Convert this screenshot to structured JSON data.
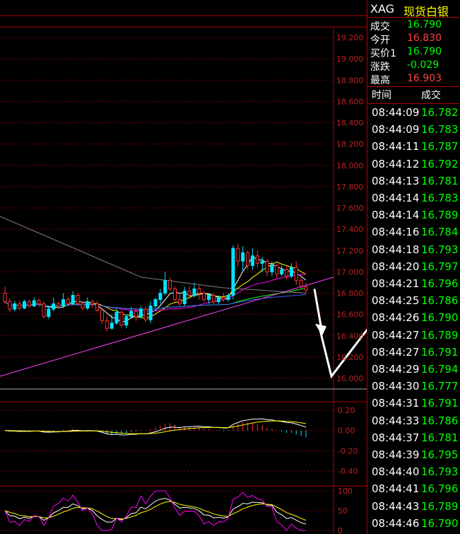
{
  "header": {
    "symbol": "XAG",
    "name": "现货白银"
  },
  "quote": [
    {
      "label": "成交",
      "value": "16.790",
      "color": "#00ff00"
    },
    {
      "label": "今开",
      "value": "16.830",
      "color": "#ff4040"
    },
    {
      "label": "买价1",
      "value": "16.790",
      "color": "#00ff00"
    },
    {
      "label": "涨跌",
      "value": "-0.029",
      "color": "#00ff00"
    },
    {
      "label": "最高",
      "value": "16.903",
      "color": "#ff4040"
    }
  ],
  "ticks_header": {
    "time": "时间",
    "price": "成交"
  },
  "ticks": [
    {
      "time": "08:44:09",
      "price": "16.782"
    },
    {
      "time": "08:44:09",
      "price": "16.783"
    },
    {
      "time": "08:44:11",
      "price": "16.787"
    },
    {
      "time": "08:44:12",
      "price": "16.792"
    },
    {
      "time": "08:44:13",
      "price": "16.781"
    },
    {
      "time": "08:44:14",
      "price": "16.783"
    },
    {
      "time": "08:44:14",
      "price": "16.789"
    },
    {
      "time": "08:44:16",
      "price": "16.784"
    },
    {
      "time": "08:44:18",
      "price": "16.793"
    },
    {
      "time": "08:44:20",
      "price": "16.797"
    },
    {
      "time": "08:44:21",
      "price": "16.796"
    },
    {
      "time": "08:44:25",
      "price": "16.786"
    },
    {
      "time": "08:44:26",
      "price": "16.790"
    },
    {
      "time": "08:44:27",
      "price": "16.789"
    },
    {
      "time": "08:44:27",
      "price": "16.791"
    },
    {
      "time": "08:44:29",
      "price": "16.794"
    },
    {
      "time": "08:44:30",
      "price": "16.777"
    },
    {
      "time": "08:44:31",
      "price": "16.791"
    },
    {
      "time": "08:44:33",
      "price": "16.786"
    },
    {
      "time": "08:44:37",
      "price": "16.781"
    },
    {
      "time": "08:44:39",
      "price": "16.795"
    },
    {
      "time": "08:44:40",
      "price": "16.793"
    },
    {
      "time": "08:44:41",
      "price": "16.796"
    },
    {
      "time": "08:44:43",
      "price": "16.789"
    },
    {
      "time": "08:44:46",
      "price": "16.790"
    }
  ],
  "chart_data": {
    "type": "candlestick",
    "price_axis": {
      "ticks": [
        "19.200",
        "19.000",
        "18.800",
        "18.600",
        "18.400",
        "18.200",
        "18.000",
        "17.800",
        "17.600",
        "17.400",
        "17.200",
        "17.000",
        "16.800",
        "16.600",
        "16.400",
        "16.200",
        "16.000"
      ],
      "range": [
        16.0,
        19.2
      ]
    },
    "macd_axis": {
      "ticks": [
        "0.20",
        "0.00",
        "-0.20",
        "-0.40"
      ],
      "range": [
        -0.4,
        0.2
      ]
    },
    "kdj_axis": {
      "ticks": [
        "100",
        "50",
        "0"
      ],
      "range": [
        0,
        100
      ]
    },
    "candles": [
      [
        16.8,
        16.72,
        16.7,
        16.86
      ],
      [
        16.72,
        16.65,
        16.62,
        16.75
      ],
      [
        16.65,
        16.7,
        16.63,
        16.73
      ],
      [
        16.7,
        16.66,
        16.64,
        16.73
      ],
      [
        16.66,
        16.72,
        16.65,
        16.74
      ],
      [
        16.72,
        16.68,
        16.66,
        16.74
      ],
      [
        16.68,
        16.73,
        16.67,
        16.76
      ],
      [
        16.73,
        16.7,
        16.67,
        16.75
      ],
      [
        16.7,
        16.58,
        16.56,
        16.72
      ],
      [
        16.58,
        16.65,
        16.56,
        16.68
      ],
      [
        16.65,
        16.7,
        16.63,
        16.76
      ],
      [
        16.7,
        16.68,
        16.66,
        16.72
      ],
      [
        16.68,
        16.74,
        16.66,
        16.8
      ],
      [
        16.74,
        16.7,
        16.68,
        16.76
      ],
      [
        16.7,
        16.78,
        16.69,
        16.82
      ],
      [
        16.78,
        16.7,
        16.68,
        16.8
      ],
      [
        16.7,
        16.66,
        16.64,
        16.72
      ],
      [
        16.66,
        16.72,
        16.64,
        16.76
      ],
      [
        16.72,
        16.7,
        16.66,
        16.74
      ],
      [
        16.7,
        16.64,
        16.62,
        16.73
      ],
      [
        16.64,
        16.54,
        16.51,
        16.66
      ],
      [
        16.54,
        16.47,
        16.44,
        16.58
      ],
      [
        16.47,
        16.52,
        16.46,
        16.6
      ],
      [
        16.52,
        16.62,
        16.5,
        16.66
      ],
      [
        16.62,
        16.5,
        16.48,
        16.64
      ],
      [
        16.5,
        16.58,
        16.47,
        16.6
      ],
      [
        16.58,
        16.63,
        16.56,
        16.67
      ],
      [
        16.63,
        16.58,
        16.54,
        16.66
      ],
      [
        16.58,
        16.65,
        16.56,
        16.68
      ],
      [
        16.65,
        16.55,
        16.53,
        16.68
      ],
      [
        16.55,
        16.68,
        16.52,
        16.72
      ],
      [
        16.68,
        16.74,
        16.66,
        16.76
      ],
      [
        16.74,
        16.8,
        16.7,
        16.84
      ],
      [
        16.8,
        16.92,
        16.78,
        17.0
      ],
      [
        16.92,
        16.84,
        16.82,
        16.95
      ],
      [
        16.84,
        16.74,
        16.72,
        16.86
      ],
      [
        16.74,
        16.7,
        16.68,
        16.8
      ],
      [
        16.7,
        16.82,
        16.68,
        16.86
      ],
      [
        16.82,
        16.78,
        16.75,
        16.86
      ],
      [
        16.78,
        16.84,
        16.76,
        16.9
      ],
      [
        16.84,
        16.8,
        16.74,
        16.88
      ],
      [
        16.8,
        16.74,
        16.72,
        16.82
      ],
      [
        16.74,
        16.78,
        16.7,
        16.8
      ],
      [
        16.78,
        16.72,
        16.7,
        16.8
      ],
      [
        16.72,
        16.76,
        16.7,
        16.78
      ],
      [
        16.76,
        16.74,
        16.72,
        16.8
      ],
      [
        16.74,
        16.78,
        16.72,
        16.8
      ],
      [
        16.78,
        17.22,
        16.74,
        17.25
      ],
      [
        17.22,
        17.1,
        17.05,
        17.26
      ],
      [
        17.1,
        17.18,
        17.0,
        17.24
      ],
      [
        17.18,
        17.06,
        17.02,
        17.2
      ],
      [
        17.06,
        17.15,
        17.02,
        17.22
      ],
      [
        17.15,
        17.08,
        17.04,
        17.2
      ],
      [
        17.08,
        17.1,
        17.0,
        17.14
      ],
      [
        17.1,
        17.0,
        16.96,
        17.12
      ],
      [
        17.0,
        17.06,
        16.96,
        17.1
      ],
      [
        17.06,
        16.98,
        16.94,
        17.08
      ],
      [
        16.98,
        17.02,
        16.96,
        17.06
      ],
      [
        17.02,
        16.96,
        16.93,
        17.05
      ],
      [
        16.96,
        17.04,
        16.94,
        17.08
      ],
      [
        17.04,
        16.92,
        16.88,
        17.1
      ],
      [
        16.92,
        16.86,
        16.84,
        16.96
      ],
      [
        16.86,
        16.83,
        16.8,
        16.9
      ]
    ]
  }
}
